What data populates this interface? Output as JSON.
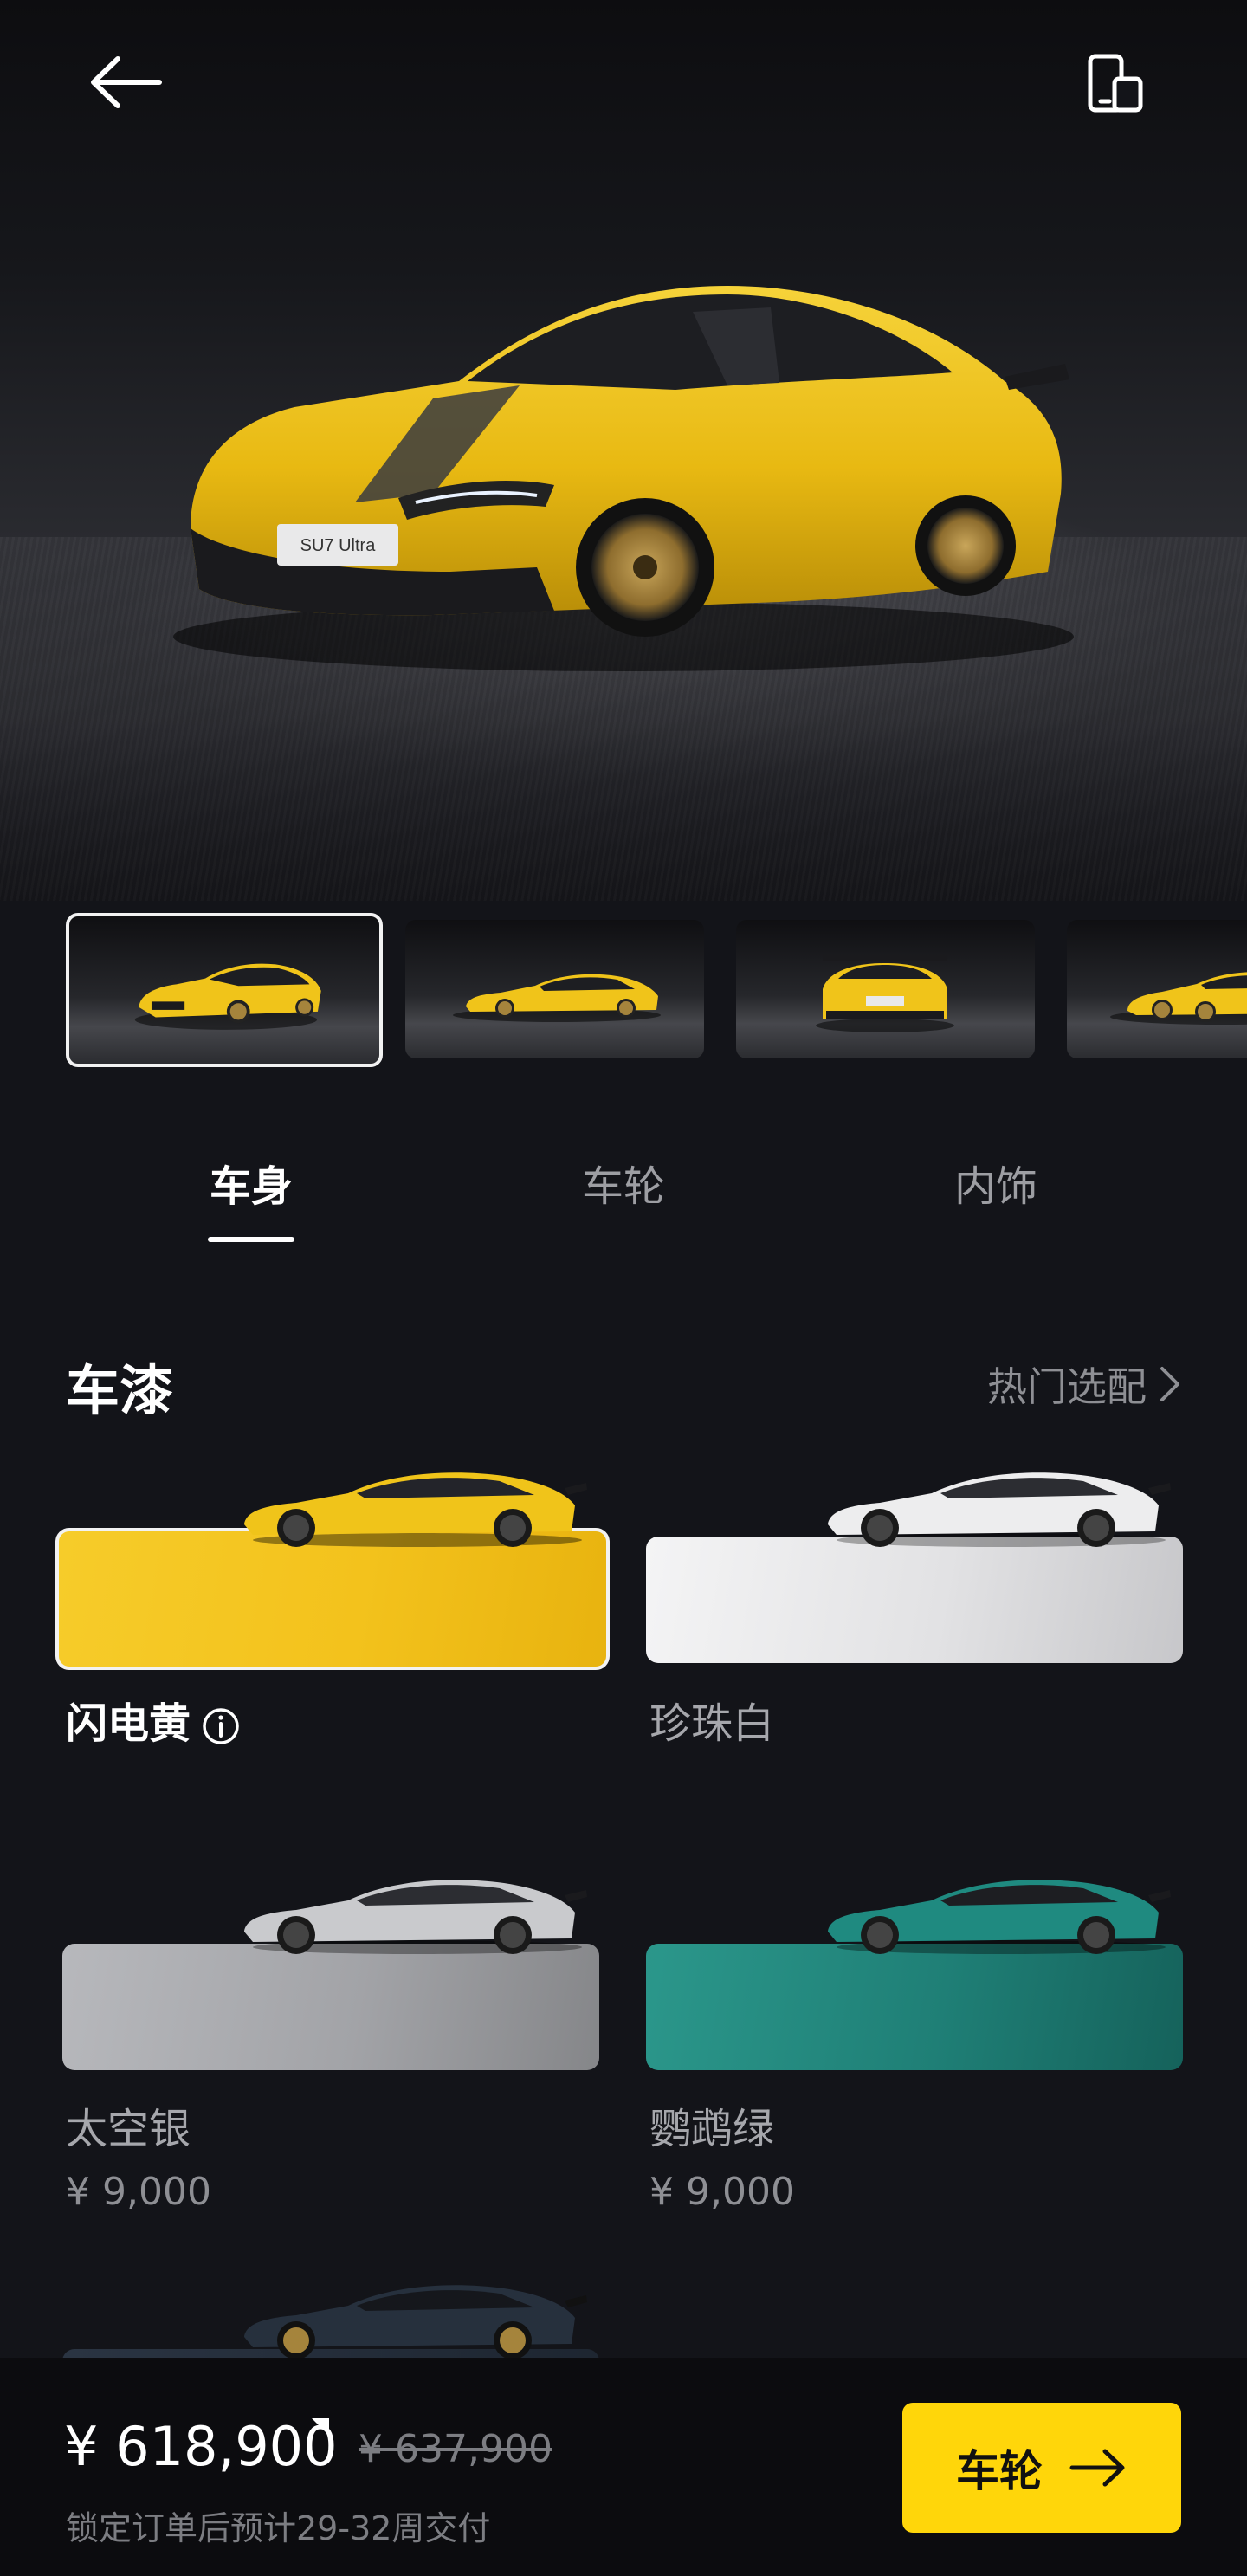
{
  "nav": {
    "back_icon": "arrow-left-icon",
    "device_icon": "phone-tablet-icon"
  },
  "gallery": {
    "thumbnails": [
      {
        "view": "front-three-quarter",
        "active": true
      },
      {
        "view": "side",
        "active": false
      },
      {
        "view": "rear",
        "active": false
      },
      {
        "view": "front-three-quarter-side",
        "active": false
      }
    ]
  },
  "tabs": [
    {
      "label": "车身",
      "active": true
    },
    {
      "label": "车轮",
      "active": false
    },
    {
      "label": "内饰",
      "active": false
    }
  ],
  "paint": {
    "title": "车漆",
    "hot_link": "热门选配",
    "colors": [
      {
        "name": "闪电黄",
        "price": "",
        "selected": true,
        "swatch": "#f7c81a"
      },
      {
        "name": "珍珠白",
        "price": "",
        "selected": false,
        "swatch": "#e4e4e6"
      },
      {
        "name": "太空银",
        "price": "¥ 9,000",
        "selected": false,
        "swatch": "#a4a5a9"
      },
      {
        "name": "鹦鹉绿",
        "price": "¥ 9,000",
        "selected": false,
        "swatch": "#1f7f76"
      }
    ]
  },
  "footer": {
    "price": "¥ 618,900",
    "original_price": "¥ 637,900",
    "delivery_note": "锁定订单后预计29-32周交付",
    "next_button": "车轮"
  },
  "colors": {
    "background": "#131419",
    "accent": "#ffd60a",
    "car_yellow": "#f2c318"
  }
}
